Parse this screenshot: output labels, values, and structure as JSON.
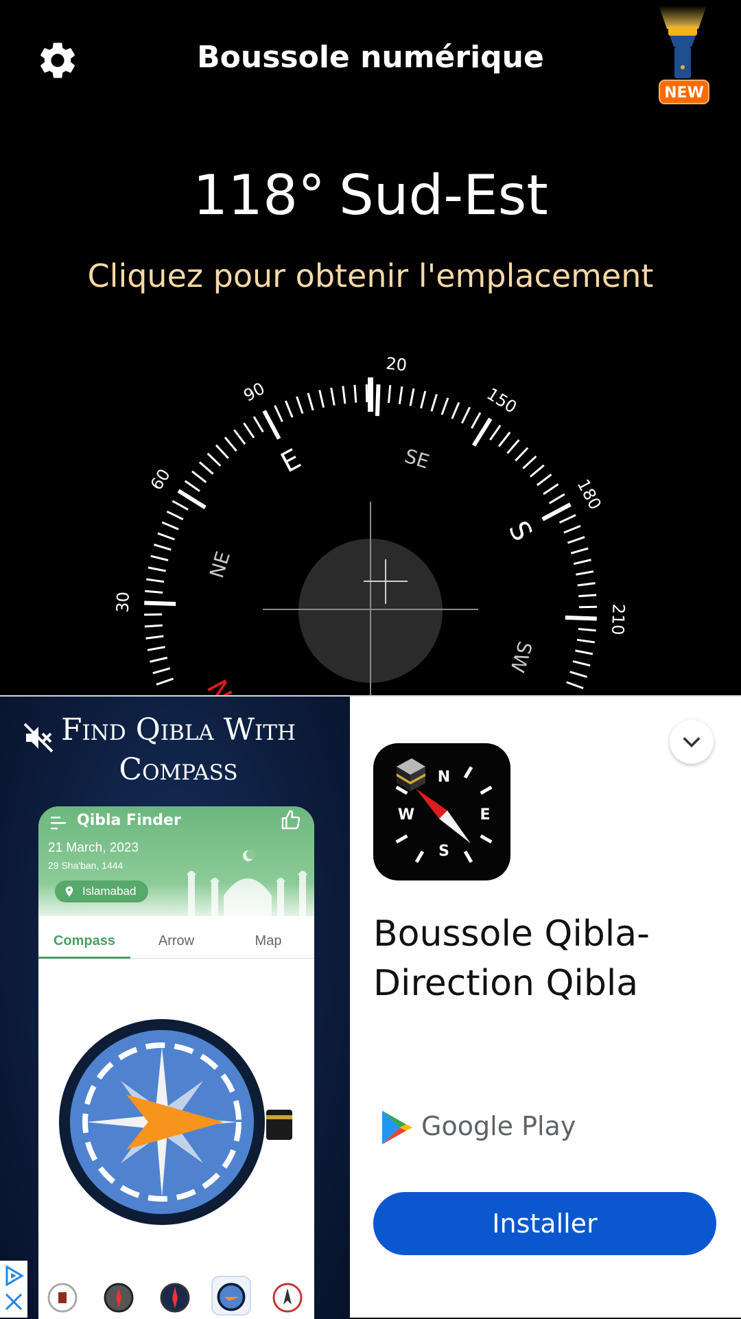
{
  "app": {
    "title": "Boussole numérique",
    "new_badge": "NEW",
    "heading_degrees": "118°",
    "heading_direction": "Sud-Est",
    "location_prompt": "Cliquez pour obtenir l'emplacement"
  },
  "dial": {
    "heading": 118,
    "degree_labels": [
      "30",
      "60",
      "90",
      "20",
      "150",
      "180",
      "210"
    ],
    "cardinal_labels": [
      "NE",
      "E",
      "SE",
      "S",
      "SW",
      "N"
    ],
    "accent_color": "#e01b1b"
  },
  "ad": {
    "media": {
      "headline": "Find Qibla With Compass",
      "phone_title": "Qibla Finder",
      "date": "21 March, 2023",
      "hijri_date": "29 Sha'ban, 1444",
      "city": "Islamabad",
      "tabs": [
        "Compass",
        "Arrow",
        "Map"
      ]
    },
    "app_name": "Boussole Qibla-Direction Qibla",
    "store": "Google Play",
    "install_label": "Installer",
    "install_color": "#0b57d0"
  }
}
